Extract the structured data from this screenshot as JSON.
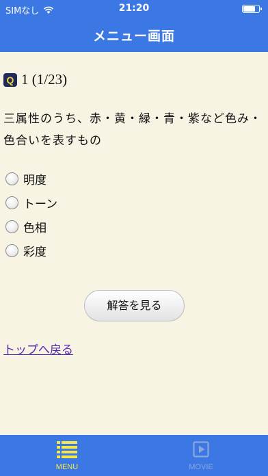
{
  "status": {
    "carrier": "SIMなし",
    "time": "21:20"
  },
  "nav": {
    "title": "メニュー画面"
  },
  "question": {
    "badge": "Q",
    "number": "1  (1/23)",
    "text": "三属性のうち、赤・黄・緑・青・紫など色み・色合いを表すもの"
  },
  "options": [
    "明度",
    "トーン",
    "色相",
    "彩度"
  ],
  "answer_button": "解答を見る",
  "back_link": "トップへ戻る",
  "tabs": [
    {
      "label": "MENU",
      "icon": "list-icon",
      "selected": true
    },
    {
      "label": "MOVIE",
      "icon": "play-icon",
      "selected": false
    }
  ],
  "colors": {
    "accent": "#3c78e4",
    "background": "#f7f4e4",
    "tab_selected": "#f5e64a",
    "tab_unselected": "#8aa7de",
    "link": "#5b2ab5"
  }
}
